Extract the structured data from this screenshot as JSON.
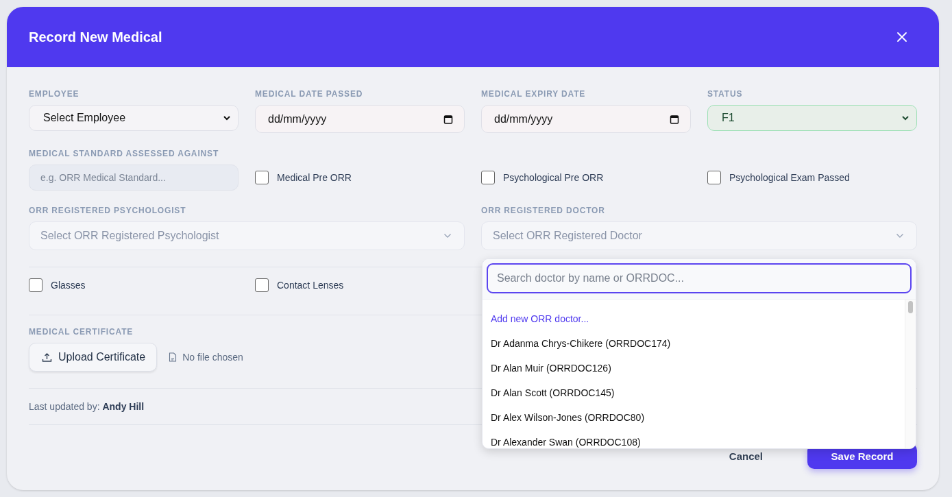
{
  "dialog": {
    "title": "Record New Medical"
  },
  "fields": [
    {
      "label": "EMPLOYEE",
      "kind": "select",
      "value": "Select Employee"
    },
    {
      "label": "MEDICAL DATE PASSED",
      "kind": "date",
      "value": "dd/mm/yyyy"
    },
    {
      "label": "MEDICAL EXPIRY DATE",
      "kind": "date",
      "value": "dd/mm/yyyy"
    },
    {
      "label": "STATUS",
      "kind": "status",
      "value": "F1"
    }
  ],
  "standard": {
    "label": "MEDICAL STANDARD ASSESSED AGAINST",
    "placeholder": "e.g. ORR Medical Standard..."
  },
  "assessment_checks": [
    {
      "label": "Medical Pre ORR",
      "checked": false
    },
    {
      "label": "Psychological Pre ORR",
      "checked": false
    },
    {
      "label": "Psychological Exam Passed",
      "checked": false
    }
  ],
  "psychologist": {
    "label": "ORR REGISTERED PSYCHOLOGIST",
    "placeholder": "Select ORR Registered Psychologist"
  },
  "doctor": {
    "label": "ORR REGISTERED DOCTOR",
    "placeholder": "Select ORR Registered Doctor"
  },
  "vision_checks": [
    {
      "label": "Glasses",
      "checked": false
    },
    {
      "label": "Contact Lenses",
      "checked": false
    }
  ],
  "certificate": {
    "label": "MEDICAL CERTIFICATE",
    "button": "Upload Certificate",
    "file_status": "No file chosen"
  },
  "last_updated": {
    "prefix": "Last updated by:",
    "name": "Andy Hill"
  },
  "buttons": {
    "cancel": "Cancel",
    "save": "Save Record"
  },
  "doctor_dropdown": {
    "open": true,
    "search_placeholder": "Search doctor by name or ORRDOC...",
    "add_link": "Add new ORR doctor...",
    "options": [
      "Dr Adanma Chrys-Chikere (ORRDOC174)",
      "Dr Alan Muir (ORRDOC126)",
      "Dr Alan Scott (ORRDOC145)",
      "Dr Alex Wilson-Jones (ORRDOC80)",
      "Dr Alexander Swan (ORRDOC108)"
    ]
  }
}
